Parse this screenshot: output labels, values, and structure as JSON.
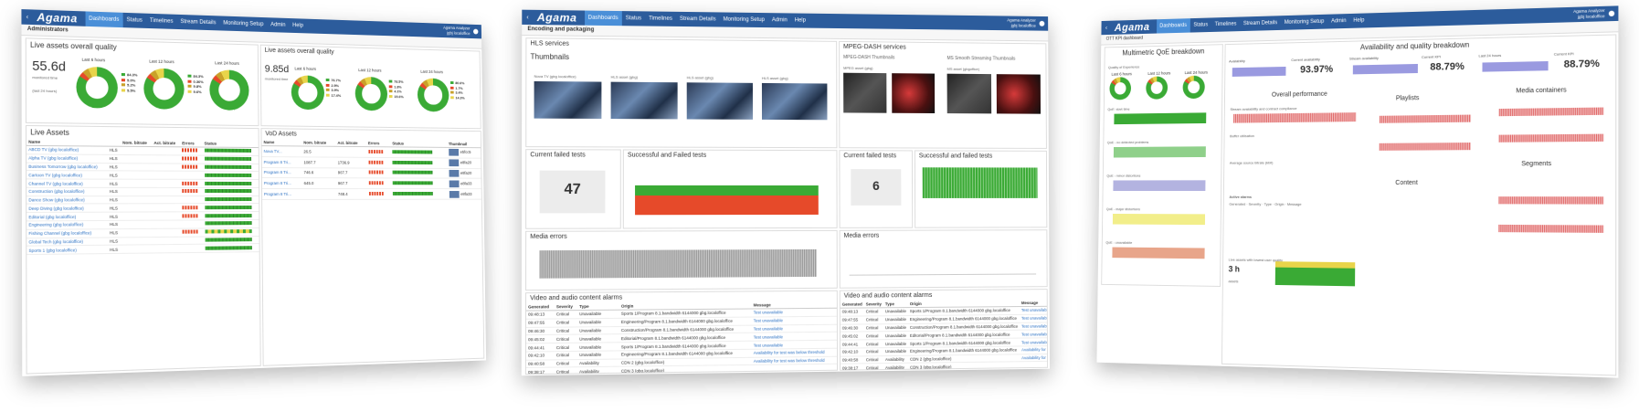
{
  "brand": {
    "logo": "Agama",
    "accent": "#2c5c9c",
    "active_tab": "#4a8fd8"
  },
  "nav": {
    "items": [
      "Dashboards",
      "Status",
      "Timelines",
      "Stream Details",
      "Monitoring Setup",
      "Admin",
      "Help"
    ]
  },
  "screen1": {
    "header": "Administrators",
    "user": [
      "Agama Analyzer",
      "jgbj localoffice"
    ],
    "qual": {
      "title": "Live assets overall quality",
      "value": "55.6d",
      "sub": "monitored time",
      "last": "(last 24 hours)",
      "periods": [
        "Last 6 hours",
        "Last 12 hours",
        "Last 24 hours"
      ],
      "legend6": [
        "84.3%",
        "5.0%",
        "5.2%",
        "5.5%"
      ],
      "legend12": [
        "84.3%",
        "0.36%",
        "9.8%",
        "9.6%"
      ],
      "legend24": [
        "85.4%",
        "4.9%",
        "5.2%",
        "4.5%"
      ]
    },
    "vod_qual": {
      "title": "Live assets overall quality",
      "value": "9.85d",
      "sub": "monitored time",
      "periods": [
        "Last 6 hours",
        "Last 12 hours",
        "Last 24 hours"
      ],
      "legend6": [
        "76.7%",
        "2.5%",
        "3.9%",
        "17.4%"
      ],
      "legend12": [
        "78.5%",
        "1.8%",
        "4.1%",
        "15.6%"
      ],
      "legend24": [
        "80.6%",
        "1.7%",
        "3.4%",
        "14.3%"
      ]
    },
    "live": {
      "title": "Live Assets",
      "columns": [
        "Name",
        "",
        "Nom. bitrate",
        "Act. bitrate",
        "Errors",
        "Status"
      ],
      "rows": [
        {
          "name": "ABCD TV (gbg localoffice)",
          "type": "HLS",
          "err": true
        },
        {
          "name": "Alpha TV (gbg localoffice)",
          "type": "HLS",
          "err": true
        },
        {
          "name": "Business Tomorrow (gbg localoffice)",
          "type": "HLS",
          "err": true
        },
        {
          "name": "Cartoon TV (gbg localoffice)",
          "type": "HLS",
          "err": false
        },
        {
          "name": "Channel TV (gbg localoffice)",
          "type": "HLS",
          "err": true
        },
        {
          "name": "Construction (gbg localoffice)",
          "type": "HLS",
          "err": true
        },
        {
          "name": "Dance Show (gbg localoffice)",
          "type": "HLS",
          "err": false
        },
        {
          "name": "Deep Diving (gbg localoffice)",
          "type": "HLS",
          "err": true
        },
        {
          "name": "Editorial (gbg localoffice)",
          "type": "HLS",
          "err": true
        },
        {
          "name": "Engineering (gbg localoffice)",
          "type": "HLS",
          "err": false
        },
        {
          "name": "Fishing Channel (gbg localoffice)",
          "type": "HLS",
          "err": true
        },
        {
          "name": "Global Tech (gbg localoffice)",
          "type": "HLS",
          "err": false
        },
        {
          "name": "Sports 1 (gbg localoffice)",
          "type": "HLS",
          "err": false
        }
      ]
    },
    "vod": {
      "title": "VoD Assets",
      "columns": [
        "Name",
        "Nom. bitrate",
        "Act. bitrate",
        "Errors",
        "Status",
        "Thumbnail"
      ],
      "rows": [
        {
          "name": "Nova TV...",
          "nom": "26.5",
          "act": "",
          "id": "e5fcc5"
        },
        {
          "name": "Program 8 Tri...",
          "nom": "1087.7",
          "act": "1736.9",
          "id": "e8fa20"
        },
        {
          "name": "Program 8 Tri...",
          "nom": "746.6",
          "act": "967.7",
          "id": "e8fa20"
        },
        {
          "name": "Program 8 Tri...",
          "nom": "645.0",
          "act": "967.7",
          "id": "e8fa33"
        },
        {
          "name": "Program 8 Tri...",
          "nom": "",
          "act": "748.4",
          "id": "e8fa33"
        }
      ]
    }
  },
  "screen2": {
    "header": "Encoding and packaging",
    "user": [
      "Agama Analyzer",
      "jgbj localoffice"
    ],
    "hls": "HLS services",
    "mpeg": "MPEG-DASH services",
    "thumbs": "Thumbnails",
    "mpeg_thumbs": "MPEG-DASH Thumbnails",
    "ms_thumbs": "MS Smooth Streaming Thumbnails",
    "thumb_labels": [
      "Nova TV (gbg localoffice)",
      "HLS asset (gbg)",
      "HLS asset (gbg)",
      "HLS asset (gbg)",
      "MPEG asset (gbg)",
      "MS asset (gbgoffice)"
    ],
    "failed_title": "Current failed tests",
    "failed_value": "47",
    "failed_title2": "Current failed tests",
    "failed_value2": "6",
    "sf_title": "Successful and Failed tests",
    "sf_title2": "Successful and failed tests",
    "media_errors": "Media errors",
    "media_errors2": "Media errors",
    "alarms_title": "Video and audio content alarms",
    "alarms_title2": "Video and audio content alarms",
    "alarm_cols": [
      "Generated",
      "Severity",
      "Type",
      "Origin",
      "Message"
    ],
    "alarms": [
      {
        "t": "09:48:13",
        "sev": "Critical",
        "type": "Unavailable",
        "origin": "Sports 1/Program 8.1.bandwidth 6144000 gbg.localoffice",
        "msg": "Test unavailable"
      },
      {
        "t": "09:47:55",
        "sev": "Critical",
        "type": "Unavailable",
        "origin": "Engineering/Program 8.1.bandwidth 6144000 gbg.localoffice",
        "msg": "Test unavailable"
      },
      {
        "t": "09:46:30",
        "sev": "Critical",
        "type": "Unavailable",
        "origin": "Construction/Program 8.1.bandwidth 6144000 gbg.localoffice",
        "msg": "Test unavailable"
      },
      {
        "t": "09:45:02",
        "sev": "Critical",
        "type": "Unavailable",
        "origin": "Editorial/Program 8.1.bandwidth 6144000 gbg.localoffice",
        "msg": "Test unavailable"
      },
      {
        "t": "09:44:41",
        "sev": "Critical",
        "type": "Unavailable",
        "origin": "Sports 1/Program 8.1.bandwidth 6144000 gbg.localoffice",
        "msg": "Test unavailable"
      },
      {
        "t": "09:42:10",
        "sev": "Critical",
        "type": "Unavailable",
        "origin": "Engineering/Program 8.1.bandwidth 6144000 gbg.localoffice",
        "msg": "Availability for test was below threshold"
      },
      {
        "t": "09:40:58",
        "sev": "Critical",
        "type": "Availability",
        "origin": "CDN 2 (gbg.localoffice)",
        "msg": "Availability for test was below threshold"
      },
      {
        "t": "09:38:17",
        "sev": "Critical",
        "type": "Availability",
        "origin": "CDN 3 (gbg.localoffice)",
        "msg": ""
      },
      {
        "t": "09:37:05",
        "sev": "Critical",
        "type": "Unallowed quality",
        "origin": "",
        "msg": ""
      }
    ]
  },
  "screen3": {
    "header": "OTT KPI dashboard",
    "user": [
      "Agama Analyzer",
      "jgbj localoffice"
    ],
    "left_title": "Multimetric QoE breakdown",
    "right_title": "Availability and quality breakdown",
    "qoe": "Quality of Experience",
    "qoe_periods": [
      "Last 6 hours",
      "Last 12 hours",
      "Last 24 hours"
    ],
    "qoe_rows": [
      "QoE: start time",
      "QoE - no detected problems",
      "QoE - minor distortions",
      "QoE - major distortions",
      "QoE - unavailable"
    ],
    "kpis": [
      {
        "label": "Availability",
        "value": ""
      },
      {
        "label": "Current availability",
        "value": "93.97%"
      },
      {
        "label": "Stream availability",
        "value": ""
      },
      {
        "label": "Current KPI",
        "value": "88.79%"
      },
      {
        "label": "Last 24 hours",
        "value": ""
      },
      {
        "label": "Current KPI",
        "value": "88.79%"
      }
    ],
    "overall": "Overall performance",
    "playlists": "Playlists",
    "media": "Media containers",
    "content": "Content",
    "segments": "Segments",
    "overall_rows": [
      "Stream availability and contract compliance",
      "Buffer utilisation",
      "Average source bitrate (kbit)"
    ],
    "alarms_title": "Active alarms",
    "alarm_cols": [
      "Generated",
      "Severity",
      "Type",
      "Origin",
      "Message"
    ],
    "bottom_title": "Live assets with lowest user quality",
    "bottom_value": "3 h",
    "bottom_sub": "assets"
  }
}
